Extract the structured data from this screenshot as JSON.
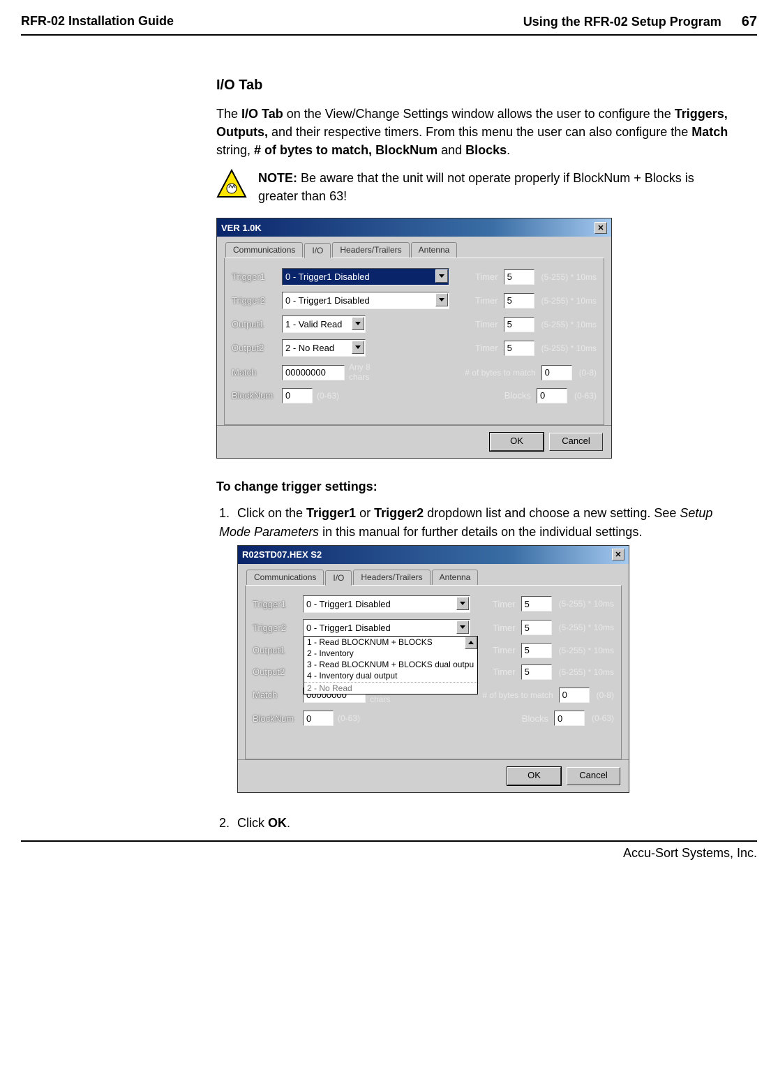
{
  "header": {
    "left": "RFR-02 Installation Guide",
    "right_title": "Using the RFR-02 Setup Program",
    "page_number": "67"
  },
  "section_title": "I/O Tab",
  "intro_sentence_1a": "The ",
  "intro_strong_1": "I/O Tab",
  "intro_sentence_1b": " on the View/Change Settings window allows the user to configure the ",
  "intro_strong_2": "Triggers, Outputs,",
  "intro_sentence_1c": " and their respective timers.  From this menu the user can also configure the ",
  "intro_strong_3": "Match",
  "intro_sentence_1d": " string, ",
  "intro_strong_4": "# of bytes to match, BlockNum",
  "intro_sentence_1e": " and ",
  "intro_strong_5": "Blocks",
  "intro_sentence_1f": ".",
  "note_label": "NOTE:",
  "note_text": " Be aware that the unit will not operate properly if BlockNum + Blocks is greater than 63!",
  "dialog1": {
    "title": "VER 1.0K",
    "tabs": [
      "Communications",
      "I/O",
      "Headers/Trailers",
      "Antenna"
    ],
    "labels": {
      "trigger1": "Trigger1",
      "trigger2": "Trigger2",
      "output1": "Output1",
      "output2": "Output2",
      "match": "Match",
      "blocknum": "BlockNum",
      "blocks": "Blocks",
      "timer": "Timer",
      "bytes_to_match": "# of bytes to match"
    },
    "values": {
      "trigger1": "0 - Trigger1 Disabled",
      "trigger2": "0 - Trigger1 Disabled",
      "output1": "1 - Valid Read",
      "output2": "2 - No Read",
      "match": "00000000",
      "blocknum": "0",
      "timer_t1": "5",
      "timer_t2": "5",
      "timer_o1": "5",
      "timer_o2": "5",
      "bytes_to_match": "0",
      "blocks": "0"
    },
    "hints": {
      "timer_range": "(5-255) * 10ms",
      "any8": "Any 8 chars",
      "bytes_range": "(0-8)",
      "block_range": "(0-63)"
    },
    "buttons": {
      "ok": "OK",
      "cancel": "Cancel"
    }
  },
  "sub_heading": "To change trigger settings:",
  "step1_a": "Click on the ",
  "step1_b": "Trigger1",
  "step1_c": " or ",
  "step1_d": "Trigger2",
  "step1_e": " dropdown list and choose a new setting. See ",
  "step1_f_italic": "Setup Mode Parameters",
  "step1_g": " in this manual for further details on the individual settings.",
  "dialog2": {
    "title": "R02STD07.HEX  S2",
    "tabs": [
      "Communications",
      "I/O",
      "Headers/Trailers",
      "Antenna"
    ],
    "labels": {
      "trigger1": "Trigger1",
      "trigger2": "Trigger2",
      "output1": "Output1",
      "output2": "Output2",
      "match": "Match",
      "blocknum": "BlockNum",
      "blocks": "Blocks",
      "timer": "Timer",
      "bytes_to_match": "# of bytes to match"
    },
    "values": {
      "trigger1": "0 - Trigger1 Disabled",
      "trigger2": "0 - Trigger1 Disabled",
      "output2_under": "2 - No Read",
      "match": "00000000",
      "blocknum": "0",
      "timer_t1": "5",
      "timer_t2": "5",
      "timer_o1": "5",
      "timer_o2": "5",
      "bytes_to_match": "0",
      "blocks": "0"
    },
    "dropdown_options": [
      "1 - Read BLOCKNUM + BLOCKS",
      "2 - Inventory",
      "3 - Read BLOCKNUM + BLOCKS dual outpu",
      "4 - Inventory dual output"
    ],
    "hints": {
      "timer_range": "(5-255) * 10ms",
      "any8": "Any 8 chars",
      "bytes_range": "(0-8)",
      "block_range": "(0-63)"
    },
    "buttons": {
      "ok": "OK",
      "cancel": "Cancel"
    }
  },
  "step2_a": "Click ",
  "step2_b": "OK",
  "step2_c": ".",
  "footer": "Accu-Sort Systems, Inc."
}
